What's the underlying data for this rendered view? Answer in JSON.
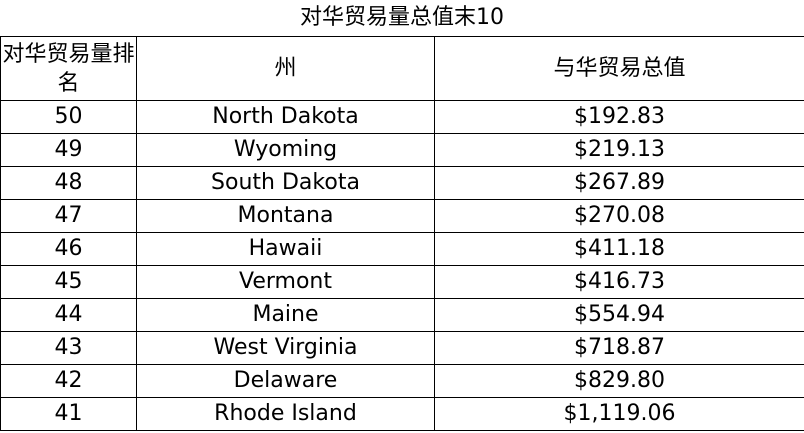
{
  "title": "对华贸易量总值末10",
  "columns": {
    "rank": "对华贸易量排名",
    "state": "州",
    "total": "与华贸易总值"
  },
  "rows": [
    {
      "rank": "50",
      "state": "North Dakota",
      "total": "$192.83"
    },
    {
      "rank": "49",
      "state": "Wyoming",
      "total": "$219.13"
    },
    {
      "rank": "48",
      "state": "South Dakota",
      "total": "$267.89"
    },
    {
      "rank": "47",
      "state": "Montana",
      "total": "$270.08"
    },
    {
      "rank": "46",
      "state": "Hawaii",
      "total": "$411.18"
    },
    {
      "rank": "45",
      "state": "Vermont",
      "total": "$416.73"
    },
    {
      "rank": "44",
      "state": "Maine",
      "total": "$554.94"
    },
    {
      "rank": "43",
      "state": "West Virginia",
      "total": "$718.87"
    },
    {
      "rank": "42",
      "state": "Delaware",
      "total": "$829.80"
    },
    {
      "rank": "41",
      "state": "Rhode Island",
      "total": "$1,119.06"
    }
  ]
}
